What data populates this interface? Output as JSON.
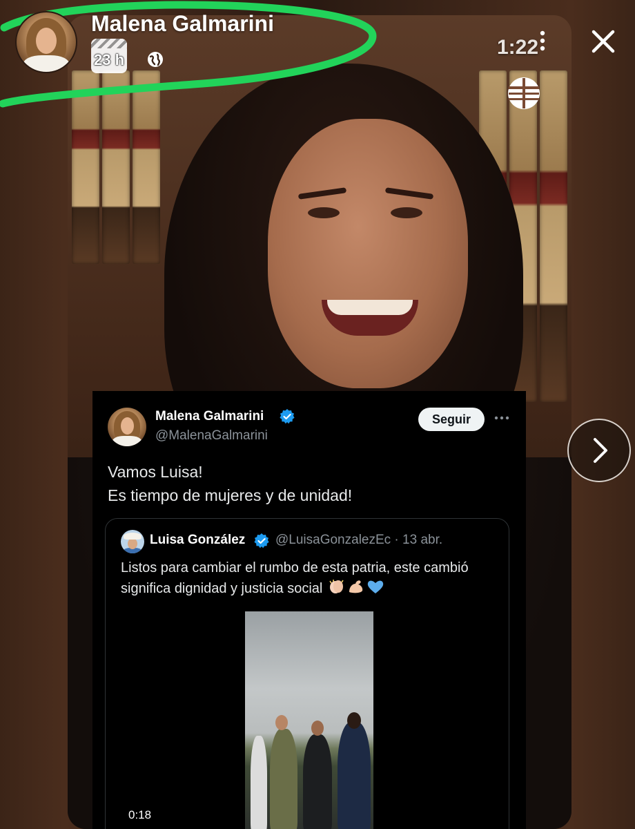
{
  "story": {
    "author_name": "Malena Galmarini",
    "time_ago": "23 h",
    "duration": "1:22",
    "icons": {
      "globe": "globe-icon",
      "more": "more-vertical-icon",
      "close": "close-icon",
      "next": "chevron-right-icon",
      "reel": "reel-icon",
      "logo": "channel-logo-icon"
    }
  },
  "tweet": {
    "name": "Malena Galmarini",
    "handle": "@MalenaGalmarini",
    "follow_label": "Seguir",
    "line1": "Vamos Luisa!",
    "line2": "Es tiempo de mujeres y de unidad!",
    "quote": {
      "name": "Luisa González",
      "meta": "@LuisaGonzalezEc · 13 abr.",
      "text_line1": "Listos para cambiar el rumbo de esta patria, este cambió",
      "text_line2": "significa dignidad y justicia social",
      "emojis": [
        "clapping-hands",
        "flexed-biceps",
        "blue-heart"
      ],
      "video_time": "0:18"
    }
  },
  "colors": {
    "highlight": "#22d35a",
    "verified": "#1d9bf0",
    "background": "#3a2418"
  }
}
